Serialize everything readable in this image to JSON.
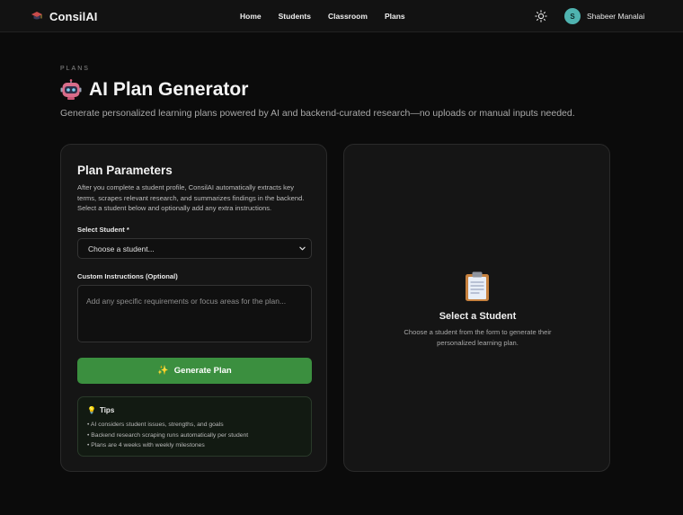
{
  "nav": {
    "brand": "ConsilAI",
    "links": [
      "Home",
      "Students",
      "Classroom",
      "Plans"
    ],
    "user_initial": "S",
    "user_name": "Shabeer Manalai"
  },
  "header": {
    "eyebrow": "PLANS",
    "title": "AI Plan Generator",
    "subtitle": "Generate personalized learning plans powered by AI and backend-curated research—no uploads or manual inputs needed."
  },
  "form": {
    "title": "Plan Parameters",
    "description": "After you complete a student profile, ConsilAI automatically extracts key terms, scrapes relevant research, and summarizes findings in the backend. Select a student below and optionally add any extra instructions.",
    "student_label": "Select Student *",
    "student_value": "Choose a student...",
    "instructions_label": "Custom Instructions (Optional)",
    "instructions_placeholder": "Add any specific requirements or focus areas for the plan...",
    "generate_label": "Generate Plan",
    "tips_title": "Tips",
    "tips": [
      "• AI considers student issues, strengths, and goals",
      "• Backend research scraping runs automatically per student",
      "• Plans are 4 weeks with weekly milestones"
    ]
  },
  "empty_state": {
    "title": "Select a Student",
    "description": "Choose a student from the form to generate their personalized learning plan."
  },
  "icons": {
    "brand": "graduation-cap-icon",
    "theme": "sun-icon",
    "title": "robot-icon",
    "generate": "sparkles-icon",
    "tips": "lightbulb-icon",
    "empty": "clipboard-icon"
  },
  "colors": {
    "background": "#0b0b0b",
    "card": "#151515",
    "primary_button": "#3b8f3f",
    "avatar": "#4fb3b0"
  }
}
